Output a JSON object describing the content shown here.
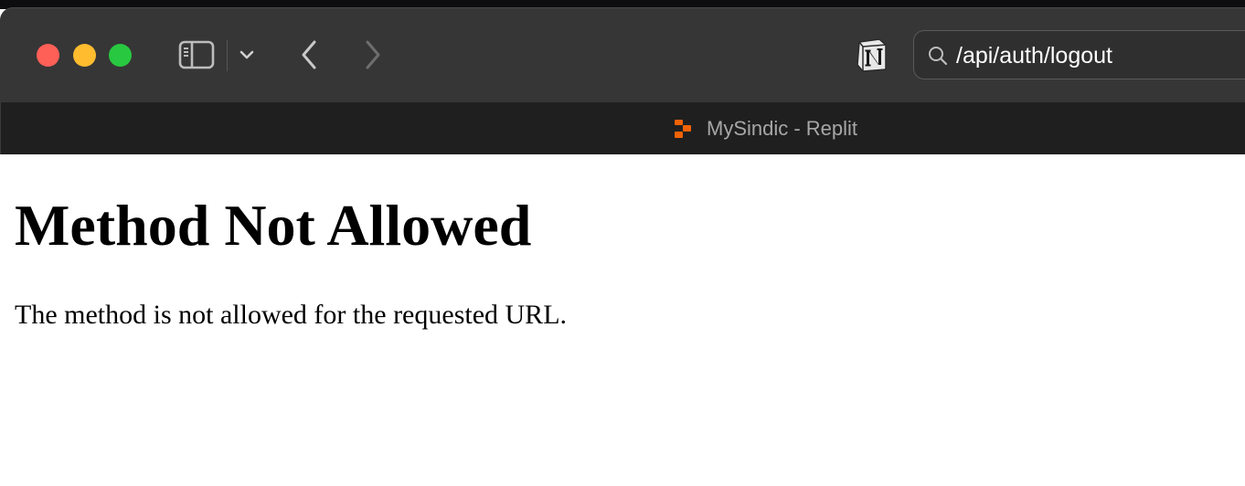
{
  "browser": {
    "window_controls": [
      "close",
      "minimize",
      "maximize"
    ],
    "toolbar": {
      "sidebar_icon": "sidebar-icon",
      "tab_overview_icon": "chevron-down-icon",
      "back_icon": "chevron-left-icon",
      "forward_icon": "chevron-right-icon",
      "extension_icon": "notion-icon"
    },
    "address_bar": {
      "icon": "search-icon",
      "text": "/api/auth/logout"
    },
    "tab": {
      "favicon": "replit-icon",
      "title": "MySindic - Replit"
    }
  },
  "page": {
    "heading": "Method Not Allowed",
    "message": "The method is not allowed for the requested URL."
  },
  "colors": {
    "toolbar_bg": "#363636",
    "tabbar_bg": "#1f1f1f",
    "close": "#fe5f57",
    "minimize": "#febc2e",
    "maximize": "#28c840",
    "replit_orange": "#f26207"
  }
}
